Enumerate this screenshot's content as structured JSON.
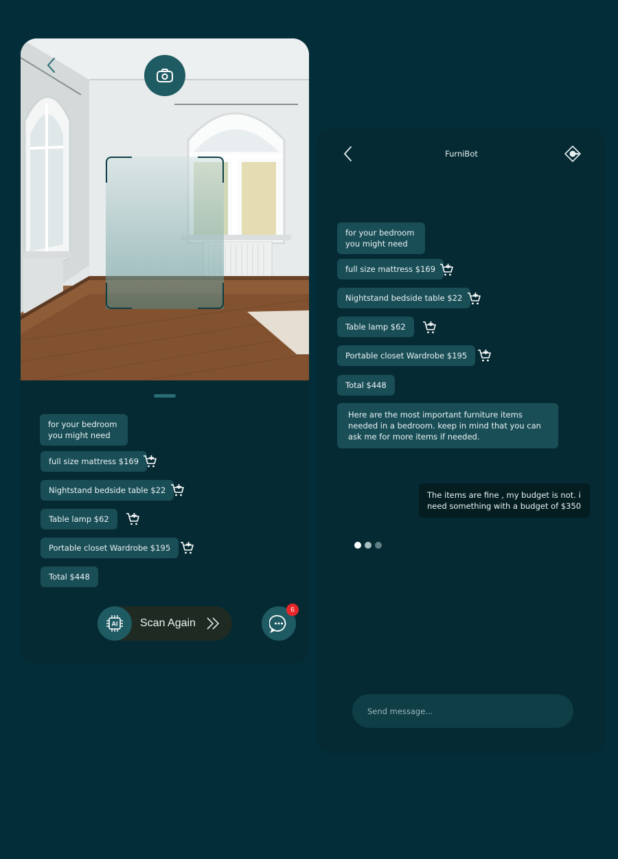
{
  "scan_screen": {
    "items": [
      {
        "label": "full size mattress $169"
      },
      {
        "label": "Nightstand bedside table $22"
      },
      {
        "label": "Table lamp $62"
      },
      {
        "label": "Portable closet Wardrobe $195"
      }
    ],
    "intro_line1": "for your bedroom",
    "intro_line2": "you might need",
    "total": "Total $448",
    "scan_again_label": "Scan Again",
    "ai_chip_label": "AI",
    "chat_badge_count": "6"
  },
  "chat_screen": {
    "title": "FurniBot",
    "intro_line1": "for your bedroom",
    "intro_line2": "you might need",
    "items": [
      {
        "label": "full size mattress $169"
      },
      {
        "label": "Nightstand bedside table $22"
      },
      {
        "label": "Table lamp $62"
      },
      {
        "label": "Portable closet Wardrobe $195"
      }
    ],
    "total": "Total $448",
    "bot_note": "Here are the most important furniture items needed in a bedroom. keep in mind that you can ask me for more items if needed.",
    "user_message": "The items are fine , my budget is not. i need something with a budget of $350",
    "input_placeholder": "Send message..."
  },
  "colors": {
    "background": "#032d38",
    "panel": "#052a33",
    "bubble": "#1a4e57",
    "accent": "#1f5b63",
    "user_bubble": "#041d20",
    "badge": "#e8262a"
  },
  "icons": {
    "back": "chevron-left-icon",
    "camera": "camera-icon",
    "cart": "cart-add-icon",
    "ai_chip": "ai-chip-icon",
    "chat": "chat-dots-icon",
    "brand": "brand-logo-icon"
  }
}
